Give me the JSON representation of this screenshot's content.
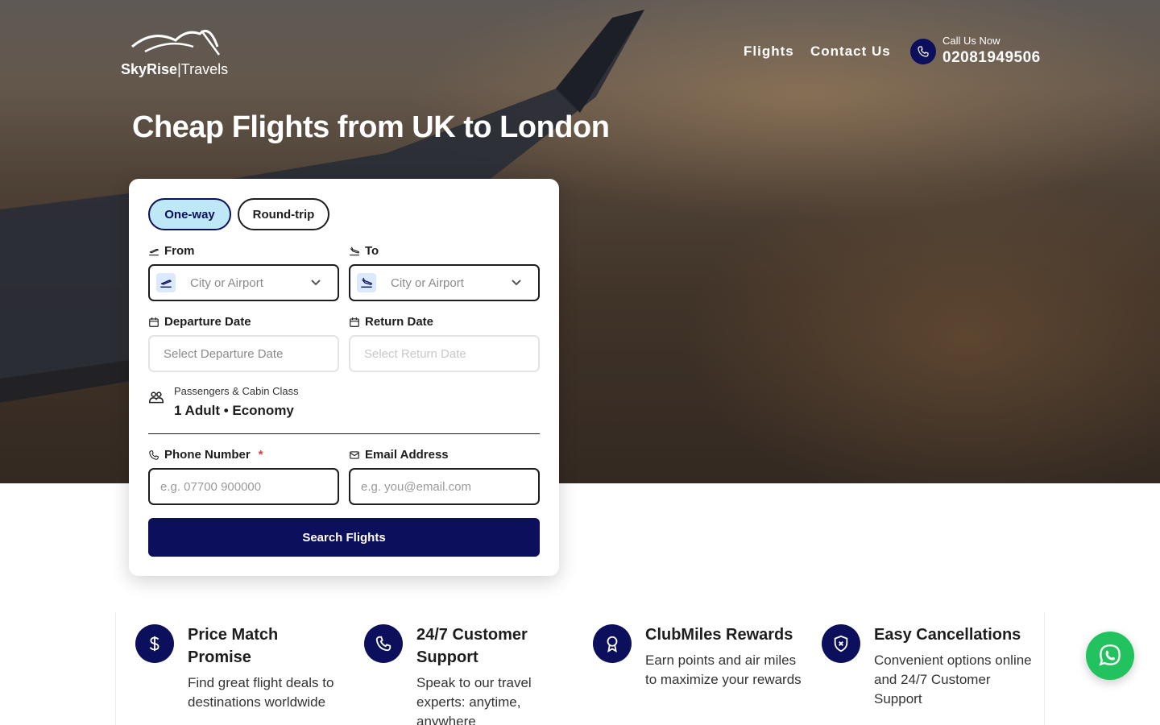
{
  "header": {
    "brand": {
      "name_bold": "SkyRise",
      "separator": "|",
      "name_light": "Travels"
    },
    "nav": {
      "flights": "Flights",
      "contact": "Contact Us"
    },
    "call": {
      "label": "Call Us Now",
      "number": "02081949506"
    }
  },
  "hero": {
    "title": "Cheap Flights from UK to London"
  },
  "search_form": {
    "trip_types": {
      "one_way": "One-way",
      "round_trip": "Round-trip",
      "selected": "One-way"
    },
    "from": {
      "label": "From",
      "placeholder": "City or Airport"
    },
    "to": {
      "label": "To",
      "placeholder": "City or Airport"
    },
    "departure": {
      "label": "Departure Date",
      "placeholder": "Select Departure Date"
    },
    "return": {
      "label": "Return Date",
      "placeholder": "Select Return Date"
    },
    "passengers": {
      "label": "Passengers & Cabin Class",
      "value": "1 Adult • Economy"
    },
    "phone": {
      "label": "Phone Number",
      "required_mark": "*",
      "placeholder": "e.g. 07700 900000"
    },
    "email": {
      "label": "Email Address",
      "placeholder": "e.g. you@email.com"
    },
    "submit": "Search Flights"
  },
  "features": [
    {
      "icon": "dollar-icon",
      "title": "Price Match Promise",
      "desc": "Find great flight deals to destinations worldwide"
    },
    {
      "icon": "phone-icon",
      "title": "24/7 Customer Support",
      "desc": "Speak to our travel experts: anytime, anywhere"
    },
    {
      "icon": "award-icon",
      "title": "ClubMiles Rewards",
      "desc": "Earn points and air miles to maximize your rewards"
    },
    {
      "icon": "shield-icon",
      "title": "Easy Cancellations",
      "desc": "Convenient options online and 24/7 Customer Support"
    }
  ],
  "colors": {
    "primary": "#0b0f5c",
    "selected_chip": "#bfe8f7",
    "whatsapp": "#22c35e"
  }
}
